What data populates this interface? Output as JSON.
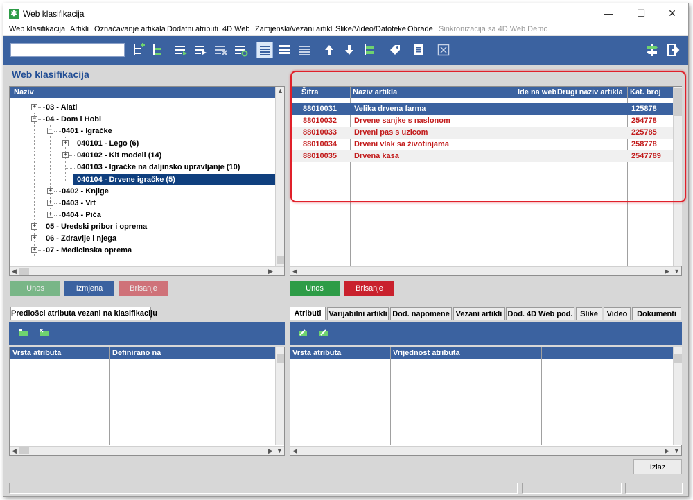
{
  "window": {
    "title": "Web klasifikacija",
    "minimize": "—",
    "maximize": "☐",
    "close": "✕"
  },
  "menu": [
    {
      "label": "Web klasifikacija"
    },
    {
      "label": "Artikli"
    },
    {
      "label": "Označavanje artikala"
    },
    {
      "label": "Dodatni atributi"
    },
    {
      "label": "4D Web"
    },
    {
      "label": "Zamjenski/vezani artikli"
    },
    {
      "label": "Slike/Video/Datoteke"
    },
    {
      "label": "Obrade"
    },
    {
      "label": "Sinkronizacija sa 4D Web Demo",
      "disabled": true
    }
  ],
  "toolbar": {
    "search_value": "",
    "colors": {
      "bar": "#3b62a0",
      "accent_green": "#2e9c47",
      "accent_red": "#c9212d"
    }
  },
  "left": {
    "title": "Web klasifikacija",
    "tree_header": "Naziv",
    "tree": [
      {
        "label": "03 - Alati",
        "expander": "+"
      },
      {
        "label": "04 - Dom i Hobi",
        "expander": "−"
      },
      {
        "label": "0401 - Igračke",
        "expander": "−"
      },
      {
        "label": "040101 - Lego (6)",
        "expander": "+"
      },
      {
        "label": "040102 - Kit modeli (14)",
        "expander": "+"
      },
      {
        "label": "040103 - Igračke na daljinsko upravljanje (10)",
        "expander": ""
      },
      {
        "label": "040104 - Drvene igračke (5)",
        "expander": "",
        "selected": true
      },
      {
        "label": "0402 - Knjige",
        "expander": "+"
      },
      {
        "label": "0403 - Vrt",
        "expander": "+"
      },
      {
        "label": "0404 - Pića",
        "expander": "+"
      },
      {
        "label": "05 - Uredski pribor i oprema",
        "expander": "+"
      },
      {
        "label": "06 - Zdravlje i njega",
        "expander": "+"
      },
      {
        "label": "07 - Medicinska oprema",
        "expander": "+"
      }
    ],
    "buttons": {
      "add": "Unos",
      "edit": "Izmjena",
      "delete": "Brisanje"
    },
    "bottom_tab": "Predlošci atributa vezani na klasifikaciju",
    "bottom_columns": [
      "Vrsta atributa",
      "Definirano na"
    ]
  },
  "right": {
    "columns": [
      "Šifra",
      "Naziv artikla",
      "Ide na web",
      "Drugi naziv artikla",
      "Kat. broj"
    ],
    "rows": [
      {
        "sifra": "88010031",
        "naziv": "Velika drvena farma",
        "kat": "125878",
        "selected": true
      },
      {
        "sifra": "88010032",
        "naziv": "Drvene sanjke s naslonom",
        "kat": "254778"
      },
      {
        "sifra": "88010033",
        "naziv": "Drveni pas s uzicom",
        "kat": "225785"
      },
      {
        "sifra": "88010034",
        "naziv": "Drveni vlak sa životinjama",
        "kat": "258778"
      },
      {
        "sifra": "88010035",
        "naziv": "Drvena kasa",
        "kat": "2547789"
      }
    ],
    "buttons": {
      "add": "Unos",
      "delete": "Brisanje"
    },
    "tabs": [
      "Atributi",
      "Varijabilni artikli",
      "Dod. napomene",
      "Vezani artikli",
      "Dod. 4D Web pod.",
      "Slike",
      "Video",
      "Dokumenti"
    ],
    "bottom_columns": [
      "Vrsta atributa",
      "Vrijednost atributa"
    ]
  },
  "exit_button": "Izlaz"
}
